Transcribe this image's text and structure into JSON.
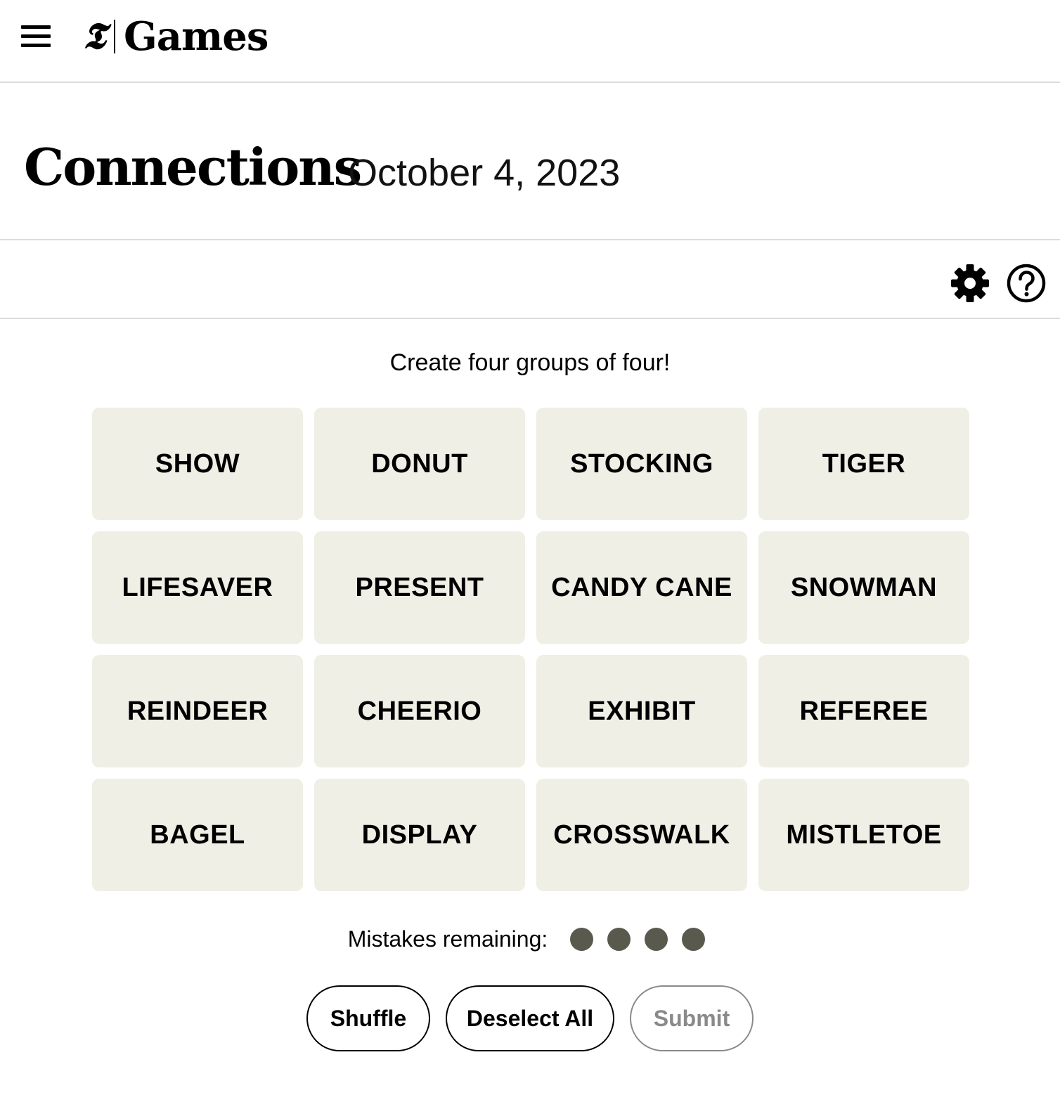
{
  "header": {
    "menu_icon": "hamburger-menu-icon",
    "logo_mark": "𝕿",
    "logo_text": "Games"
  },
  "title": {
    "game_name": "Connections",
    "date": "October 4, 2023"
  },
  "toolbar": {
    "settings_icon": "gear-icon",
    "help_icon": "question-mark-icon"
  },
  "instructions": "Create four groups of four!",
  "tiles": [
    "SHOW",
    "DONUT",
    "STOCKING",
    "TIGER",
    "LIFESAVER",
    "PRESENT",
    "CANDY CANE",
    "SNOWMAN",
    "REINDEER",
    "CHEERIO",
    "EXHIBIT",
    "REFEREE",
    "BAGEL",
    "DISPLAY",
    "CROSSWALK",
    "MISTLETOE"
  ],
  "mistakes": {
    "label": "Mistakes remaining:",
    "remaining": 4
  },
  "buttons": {
    "shuffle": "Shuffle",
    "deselect_all": "Deselect All",
    "submit": "Submit"
  },
  "colors": {
    "tile_bg": "#efefe6",
    "dot": "#5a594e",
    "submit_disabled": "#8a8a8a"
  }
}
